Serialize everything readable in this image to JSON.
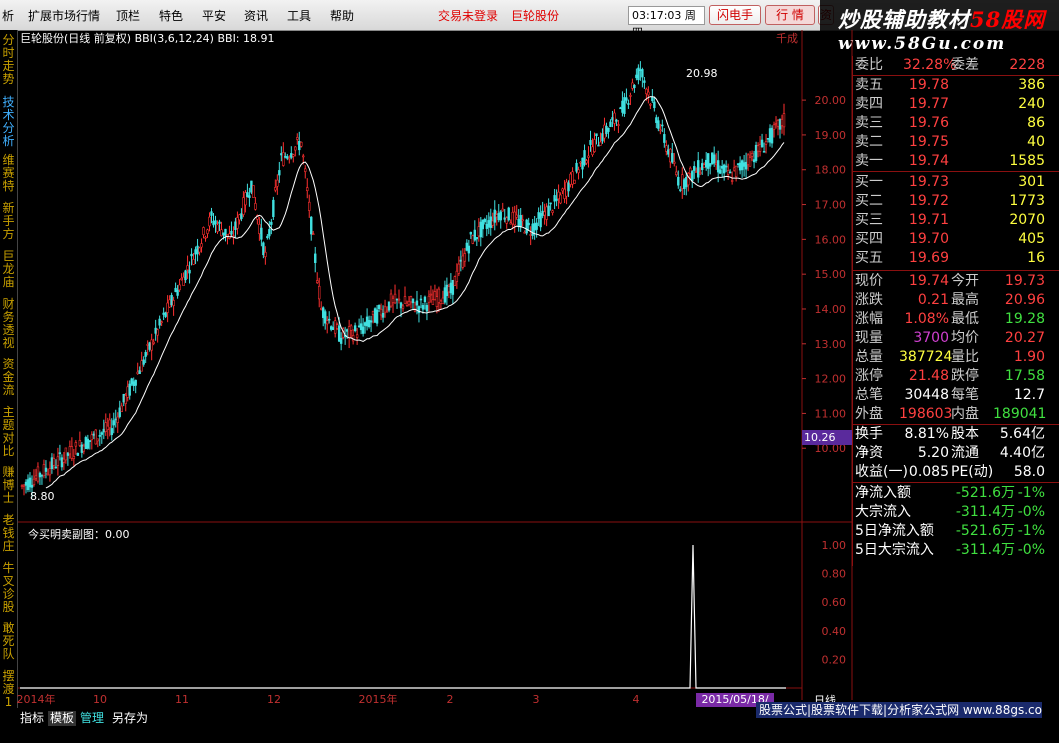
{
  "menubar": {
    "items": [
      "析",
      "扩展市场行情",
      "顶栏",
      "特色",
      "平安",
      "资讯",
      "工具",
      "帮助"
    ],
    "login_status": "交易未登录",
    "stock_name": "巨轮股份",
    "clock": "03:17:03 周四",
    "buttons": [
      "闪电手",
      "行 情",
      "资"
    ]
  },
  "watermark": {
    "line1a": "炒股辅助教材",
    "line1b": "58股网",
    "line2": "www.58Gu.com"
  },
  "left_tabs": [
    "分时走势",
    "技术分析",
    "维赛特",
    "新手方",
    "巨龙庙",
    "财务透视",
    "资金流",
    "主题对比",
    "赚博士",
    "老钱庄",
    "牛叉诊股",
    "敢死队",
    "摆渡1"
  ],
  "main_chart": {
    "indicator_header": "巨轮股份(日线 前复权) BBI(3,6,12,24)  BBI: 18.91",
    "high_label": "20.98",
    "low_label": "8.80",
    "last_price_box": "10.26",
    "y_axis": [
      "20.00",
      "19.00",
      "18.00",
      "17.00",
      "16.00",
      "15.00",
      "14.00",
      "13.00",
      "12.00",
      "11.00",
      "10.00"
    ],
    "y_axis_top": "千成"
  },
  "sub_chart": {
    "header": "今买明卖副图：0.00",
    "y_axis": [
      "1.00",
      "0.80",
      "0.60",
      "0.40",
      "0.20"
    ]
  },
  "x_axis": [
    "2014年",
    "10",
    "11",
    "12",
    "2015年",
    "2",
    "3",
    "4"
  ],
  "date_label": "2015/05/18/",
  "period_label": "日线",
  "colors": {
    "up": "#ff3030",
    "down": "#40e0e0",
    "bbi": "#ffffff",
    "grid": "#8a1010"
  },
  "quote": {
    "ratio": {
      "label": "委比",
      "value": "32.28%",
      "label2": "委差",
      "value2": "2228"
    },
    "sells": [
      {
        "label": "卖五",
        "price": "19.78",
        "vol": "386"
      },
      {
        "label": "卖四",
        "price": "19.77",
        "vol": "240"
      },
      {
        "label": "卖三",
        "price": "19.76",
        "vol": "86"
      },
      {
        "label": "卖二",
        "price": "19.75",
        "vol": "40"
      },
      {
        "label": "卖一",
        "price": "19.74",
        "vol": "1585"
      }
    ],
    "buys": [
      {
        "label": "买一",
        "price": "19.73",
        "vol": "301"
      },
      {
        "label": "买二",
        "price": "19.72",
        "vol": "1773"
      },
      {
        "label": "买三",
        "price": "19.71",
        "vol": "2070"
      },
      {
        "label": "买四",
        "price": "19.70",
        "vol": "405"
      },
      {
        "label": "买五",
        "price": "19.69",
        "vol": "16"
      }
    ],
    "stats": [
      {
        "l1": "现价",
        "v1": "19.74",
        "l2": "今开",
        "v2": "19.73"
      },
      {
        "l1": "涨跌",
        "v1": "0.21",
        "l2": "最高",
        "v2": "20.96"
      },
      {
        "l1": "涨幅",
        "v1": "1.08%",
        "l2": "最低",
        "v2": "19.28"
      },
      {
        "l1": "现量",
        "v1": "3700",
        "l2": "均价",
        "v2": "20.27"
      },
      {
        "l1": "总量",
        "v1": "387724",
        "l2": "量比",
        "v2": "1.90"
      },
      {
        "l1": "涨停",
        "v1": "21.48",
        "l2": "跌停",
        "v2": "17.58"
      },
      {
        "l1": "总笔",
        "v1": "30448",
        "l2": "每笔",
        "v2": "12.7"
      },
      {
        "l1": "外盘",
        "v1": "198603",
        "l2": "内盘",
        "v2": "189041"
      }
    ],
    "fund": [
      {
        "l1": "换手",
        "v1": "8.81%",
        "l2": "股本",
        "v2": "5.64亿"
      },
      {
        "l1": "净资",
        "v1": "5.20",
        "l2": "流通",
        "v2": "4.40亿"
      },
      {
        "l1": "收益(一)",
        "v1": "0.085",
        "l2": "PE(动)",
        "v2": "58.0"
      }
    ],
    "flows": [
      {
        "label": "净流入额",
        "value": "-521.6万",
        "pct": "-1%"
      },
      {
        "label": "大宗流入",
        "value": "-311.4万",
        "pct": "-0%"
      },
      {
        "label": "5日净流入额",
        "value": "-521.6万",
        "pct": "-1%"
      },
      {
        "label": "5日大宗流入",
        "value": "-311.4万",
        "pct": "-0%"
      }
    ]
  },
  "bottom_tabs": [
    "指标",
    "模板",
    "管理",
    "另存为"
  ],
  "ad_text": "股票公式|股票软件下载|分析家公式网 www.88gs.com"
}
